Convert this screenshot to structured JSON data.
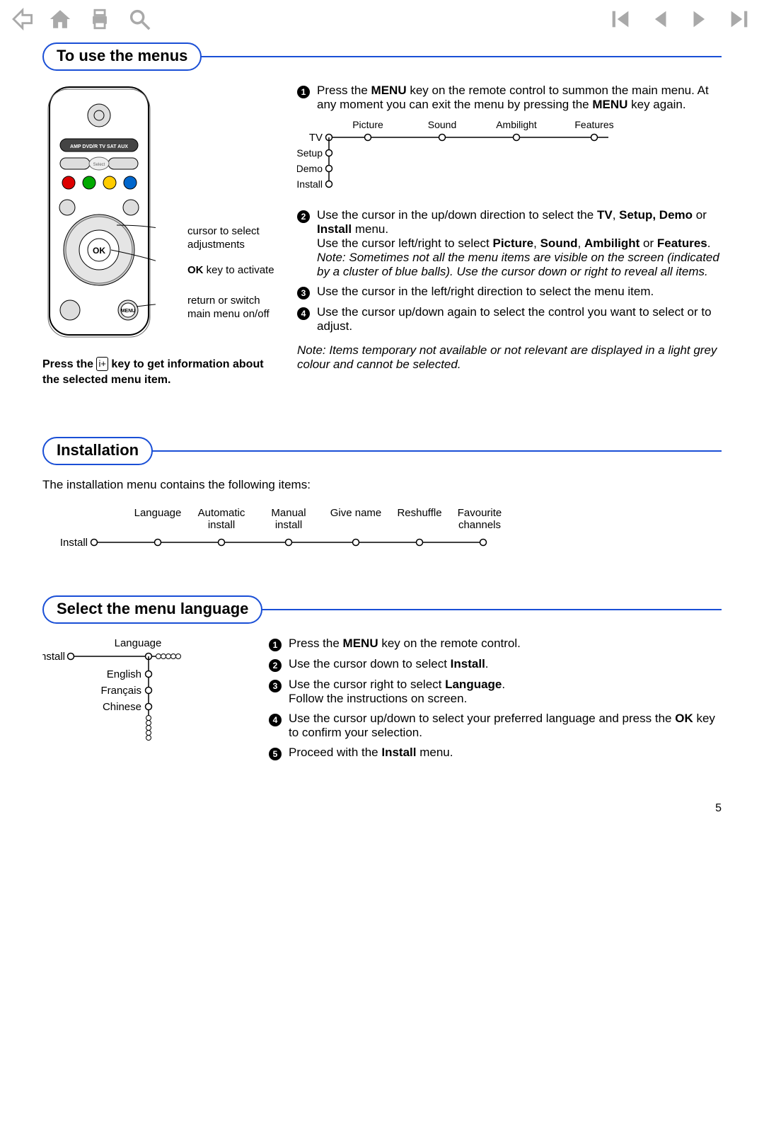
{
  "page_number": "5",
  "sections": {
    "use_menus": {
      "title": "To use the menus",
      "remote_callouts": {
        "c1": "cursor to select adjustments",
        "c2a": "OK",
        "c2b": " key to activate",
        "c3": "return or switch main menu on/off"
      },
      "info_tip_a": "Press the ",
      "info_tip_b": " key to get information about the selected menu item.",
      "s1a": "Press the ",
      "s1b": "MENU",
      "s1c": " key on the remote control to summon the main menu. At any moment you can exit the menu by pressing the ",
      "s1d": "MENU",
      "s1e": " key again.",
      "s2a": "Use the cursor in the up/down direction to select the ",
      "s2b": "TV",
      "s2c": ", ",
      "s2d": "Setup, Demo",
      "s2e": " or ",
      "s2f": "Install",
      "s2g": " menu.",
      "s2h": "Use the cursor left/right to select ",
      "s2i": "Picture",
      "s2j": ", ",
      "s2k": "Sound",
      "s2l": ", ",
      "s2m": "Ambilight",
      "s2n": " or ",
      "s2o": "Features",
      "s2p": ".",
      "s2note": "Note: Sometimes not all the menu items are visible on the screen (indicated by a cluster of blue balls). Use the cursor down or right to reveal all items.",
      "s3": "Use the cursor in the left/right direction to select the menu item.",
      "s4": "Use the cursor up/down again to select the control you want to select or to adjust.",
      "bottom_note": "Note: Items temporary not available or not relevant are displayed in a light grey colour and cannot be selected.",
      "menu": {
        "rows": [
          "TV",
          "Setup",
          "Demo",
          "Install"
        ],
        "cols": [
          "Picture",
          "Sound",
          "Ambilight",
          "Features"
        ]
      }
    },
    "installation": {
      "title": "Installation",
      "intro": "The installation menu contains the following items:",
      "root": "Install",
      "items": [
        "Language",
        "Automatic install",
        "Manual install",
        "Give name",
        "Reshuffle",
        "Favourite channels"
      ]
    },
    "select_lang": {
      "title": "Select the menu language",
      "diagram": {
        "root": "Install",
        "heading": "Language",
        "items": [
          "English",
          "Français",
          "Chinese"
        ]
      },
      "s1a": "Press the ",
      "s1b": "MENU",
      "s1c": " key on the remote control.",
      "s2a": "Use the cursor down to select ",
      "s2b": "Install",
      "s2c": ".",
      "s3a": "Use the cursor right to select ",
      "s3b": "Language",
      "s3c": ".",
      "s3d": "Follow the instructions on screen.",
      "s4a": "Use the cursor up/down to select your preferred language and press the ",
      "s4b": "OK",
      "s4c": " key to confirm your selection.",
      "s5a": "Proceed with the ",
      "s5b": "Install",
      "s5c": " menu."
    }
  }
}
